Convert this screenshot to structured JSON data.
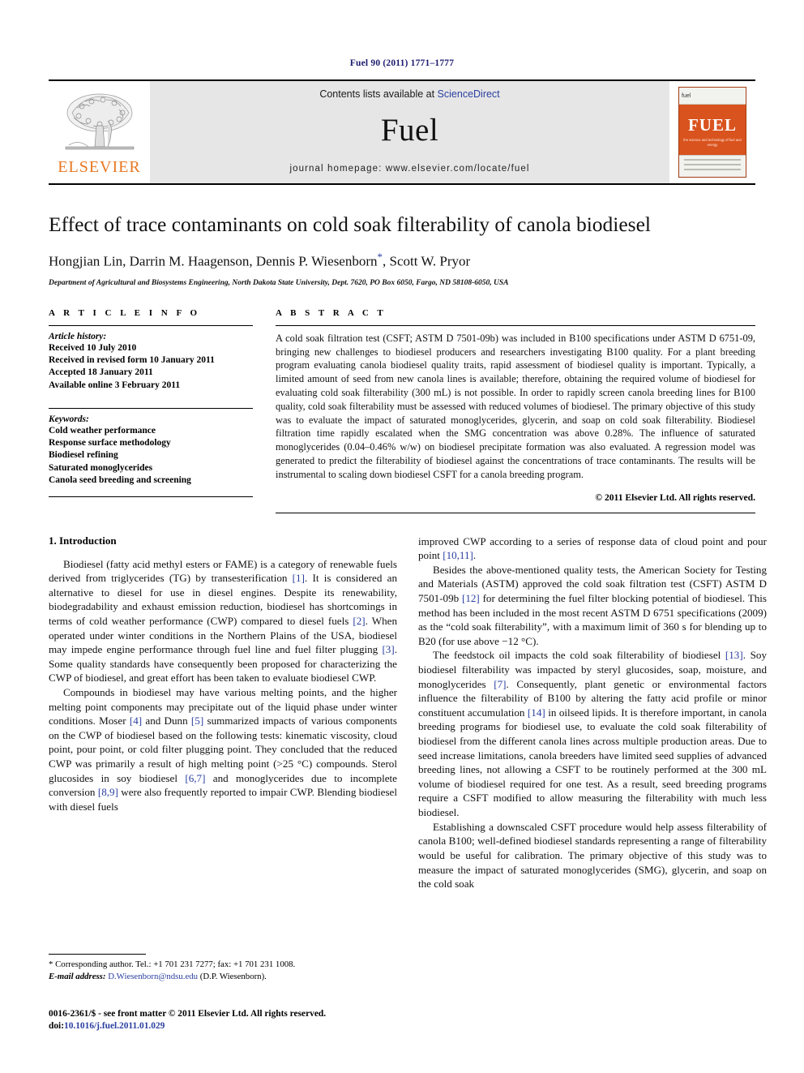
{
  "running_head": "Fuel 90 (2011) 1771–1777",
  "masthead": {
    "contents_prefix": "Contents lists available at ",
    "sciencedirect": "ScienceDirect",
    "journal_name": "Fuel",
    "homepage": "journal homepage: www.elsevier.com/locate/fuel",
    "publisher_logo_text": "ELSEVIER",
    "publisher_logo_icon": "elsevier-tree-icon",
    "cover": {
      "masthead_small": "fuel",
      "title": "FUEL",
      "subtitle": "the science and technology of fuel and energy"
    }
  },
  "article": {
    "title": "Effect of trace contaminants on cold soak filterability of canola biodiesel",
    "authors": "Hongjian Lin, Darrin M. Haagenson, Dennis P. Wiesenborn",
    "authors_tail": ", Scott W. Pryor",
    "corresponding_marker": "*",
    "affiliation": "Department of Agricultural and Biosystems Engineering, North Dakota State University, Dept. 7620, PO Box 6050, Fargo, ND 58108-6050, USA"
  },
  "article_info": {
    "heading": "A R T I C L E   I N F O",
    "history_title": "Article history:",
    "history": [
      "Received 10 July 2010",
      "Received in revised form 10 January 2011",
      "Accepted 18 January 2011",
      "Available online 3 February 2011"
    ],
    "keywords_title": "Keywords:",
    "keywords": [
      "Cold weather performance",
      "Response surface methodology",
      "Biodiesel refining",
      "Saturated monoglycerides",
      "Canola seed breeding and screening"
    ]
  },
  "abstract": {
    "heading": "A B S T R A C T",
    "text": "A cold soak filtration test (CSFT; ASTM D 7501-09b) was included in B100 specifications under ASTM D 6751-09, bringing new challenges to biodiesel producers and researchers investigating B100 quality. For a plant breeding program evaluating canola biodiesel quality traits, rapid assessment of biodiesel quality is important. Typically, a limited amount of seed from new canola lines is available; therefore, obtaining the required volume of biodiesel for evaluating cold soak filterability (300 mL) is not possible. In order to rapidly screen canola breeding lines for B100 quality, cold soak filterability must be assessed with reduced volumes of biodiesel. The primary objective of this study was to evaluate the impact of saturated monoglycerides, glycerin, and soap on cold soak filterability. Biodiesel filtration time rapidly escalated when the SMG concentration was above 0.28%. The influence of saturated monoglycerides (0.04–0.46% w/w) on biodiesel precipitate formation was also evaluated. A regression model was generated to predict the filterability of biodiesel against the concentrations of trace contaminants. The results will be instrumental to scaling down biodiesel CSFT for a canola breeding program.",
    "copyright": "© 2011 Elsevier Ltd. All rights reserved."
  },
  "body": {
    "section_heading": "1. Introduction",
    "left_paragraphs": [
      "Biodiesel (fatty acid methyl esters or FAME) is a category of renewable fuels derived from triglycerides (TG) by transesterification [1]. It is considered an alternative to diesel for use in diesel engines. Despite its renewability, biodegradability and exhaust emission reduction, biodiesel has shortcomings in terms of cold weather performance (CWP) compared to diesel fuels [2]. When operated under winter conditions in the Northern Plains of the USA, biodiesel may impede engine performance through fuel line and fuel filter plugging [3]. Some quality standards have consequently been proposed for characterizing the CWP of biodiesel, and great effort has been taken to evaluate biodiesel CWP.",
      "Compounds in biodiesel may have various melting points, and the higher melting point components may precipitate out of the liquid phase under winter conditions. Moser [4] and Dunn [5] summarized impacts of various components on the CWP of biodiesel based on the following tests: kinematic viscosity, cloud point, pour point, or cold filter plugging point. They concluded that the reduced CWP was primarily a result of high melting point (>25 °C) compounds. Sterol glucosides in soy biodiesel [6,7] and monoglycerides due to incomplete conversion [8,9] were also frequently reported to impair CWP. Blending biodiesel with diesel fuels"
    ],
    "right_paragraphs": [
      "improved CWP according to a series of response data of cloud point and pour point [10,11].",
      "Besides the above-mentioned quality tests, the American Society for Testing and Materials (ASTM) approved the cold soak filtration test (CSFT) ASTM D 7501-09b [12] for determining the fuel filter blocking potential of biodiesel. This method has been included in the most recent ASTM D 6751 specifications (2009) as the “cold soak filterability”, with a maximum limit of 360 s for blending up to B20 (for use above −12 °C).",
      "The feedstock oil impacts the cold soak filterability of biodiesel [13]. Soy biodiesel filterability was impacted by steryl glucosides, soap, moisture, and monoglycerides [7]. Consequently, plant genetic or environmental factors influence the filterability of B100 by altering the fatty acid profile or minor constituent accumulation [14] in oilseed lipids. It is therefore important, in canola breeding programs for biodiesel use, to evaluate the cold soak filterability of biodiesel from the different canola lines across multiple production areas. Due to seed increase limitations, canola breeders have limited seed supplies of advanced breeding lines, not allowing a CSFT to be routinely performed at the 300 mL volume of biodiesel required for one test. As a result, seed breeding programs require a CSFT modified to allow measuring the filterability with much less biodiesel.",
      "Establishing a downscaled CSFT procedure would help assess filterability of canola B100; well-defined biodiesel standards representing a range of filterability would be useful for calibration. The primary objective of this study was to measure the impact of saturated monoglycerides (SMG), glycerin, and soap on the cold soak"
    ]
  },
  "footnote": {
    "corresponding": "* Corresponding author. Tel.: +1 701 231 7277; fax: +1 701 231 1008.",
    "email_label": "E-mail address:",
    "email": "D.Wiesenborn@ndsu.edu",
    "email_tail": " (D.P. Wiesenborn)."
  },
  "footer": {
    "issn_line": "0016-2361/$ - see front matter © 2011 Elsevier Ltd. All rights reserved.",
    "doi_label": "doi:",
    "doi": "10.1016/j.fuel.2011.01.029"
  },
  "colors": {
    "link": "#2b3fa0",
    "running_head": "#1a1a6e",
    "elsevier_orange": "#e87722",
    "masthead_grey": "#e6e6e6"
  }
}
